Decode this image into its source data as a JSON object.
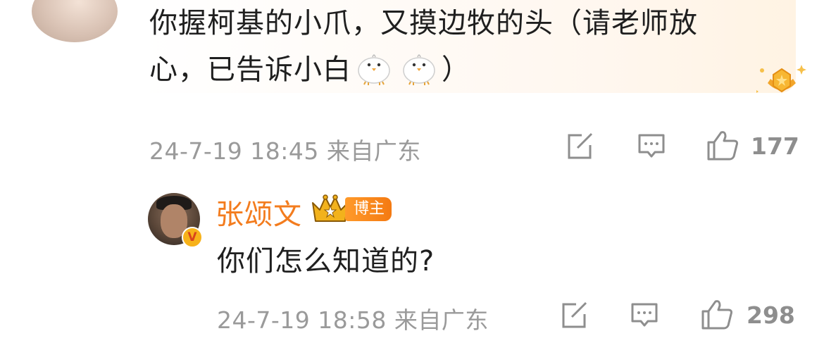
{
  "comment": {
    "line1": "你握柯基的小爪，又摸边牧的头（请老师放",
    "line2_prefix": "心，已告诉小白",
    "line2_suffix": "）",
    "emoji": "chick-emoji",
    "timestamp": "24-7-19 18:45 来自广东",
    "likes": "177"
  },
  "reply": {
    "username": "张颂文",
    "tag": "博主",
    "text": "你们怎么知道的?",
    "timestamp": "24-7-19 18:58 来自广东",
    "likes": "298"
  },
  "icons": {
    "share": "share-icon",
    "comment": "comment-icon",
    "like": "thumbs-up-icon",
    "crown": "crown-icon",
    "verified": "verified-v-icon",
    "gem": "gem-badge-icon"
  },
  "colors": {
    "username": "#f37c1e",
    "meta": "#9a9a9a",
    "text": "#1f1f1f"
  },
  "verified_label": "V"
}
